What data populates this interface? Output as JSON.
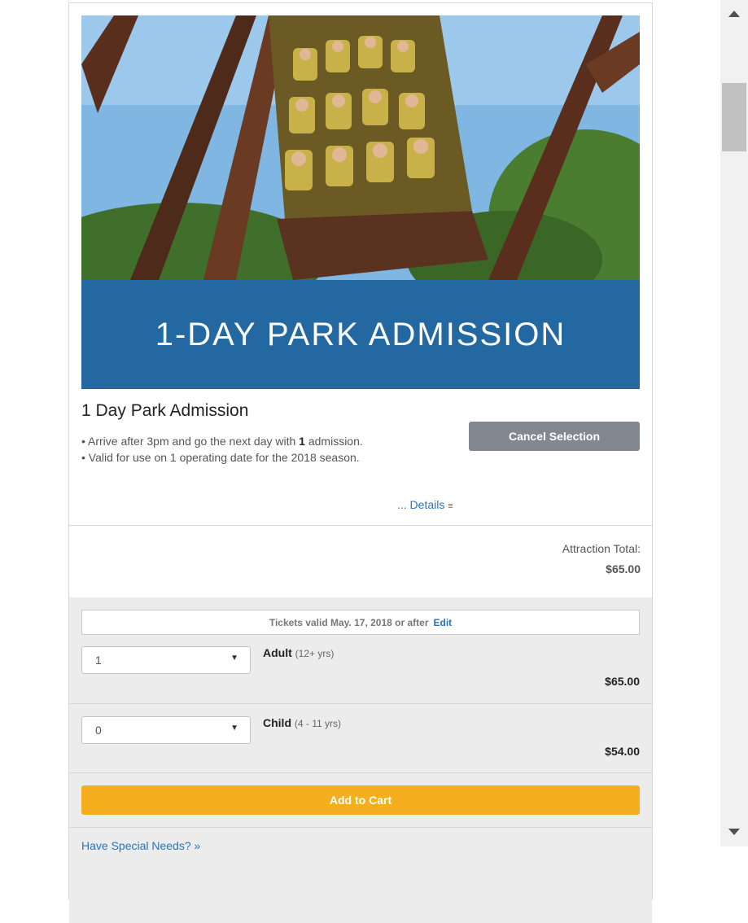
{
  "product": {
    "image_caption": "1-DAY PARK ADMISSION",
    "title": "1 Day Park Admission",
    "bullet1_before": "• Arrive after 3pm and go the next day with ",
    "bullet1_bold": "1",
    "bullet1_after": " admission.",
    "bullet2": "• Valid for use on 1 operating date for the 2018 season.",
    "cancel_label": "Cancel Selection",
    "details_label": "... Details",
    "details_icon": "double-chevron-down-icon"
  },
  "totals": {
    "label": "Attraction Total:",
    "value": "$65.00"
  },
  "tickets": {
    "valid_text": "Tickets valid May. 17, 2018 or after",
    "edit_label": "Edit",
    "types": [
      {
        "qty": "1",
        "label": "Adult",
        "age": "(12+ yrs)",
        "price": "$65.00"
      },
      {
        "qty": "0",
        "label": "Child",
        "age": "(4 - 11 yrs)",
        "price": "$54.00"
      }
    ],
    "add_to_cart": "Add to Cart",
    "special_needs": "Have Special Needs? »"
  },
  "colors": {
    "accent_blue": "#2468a2",
    "add_button": "#f5ae1d",
    "cancel_button": "#828790",
    "link": "#2a74b8"
  }
}
